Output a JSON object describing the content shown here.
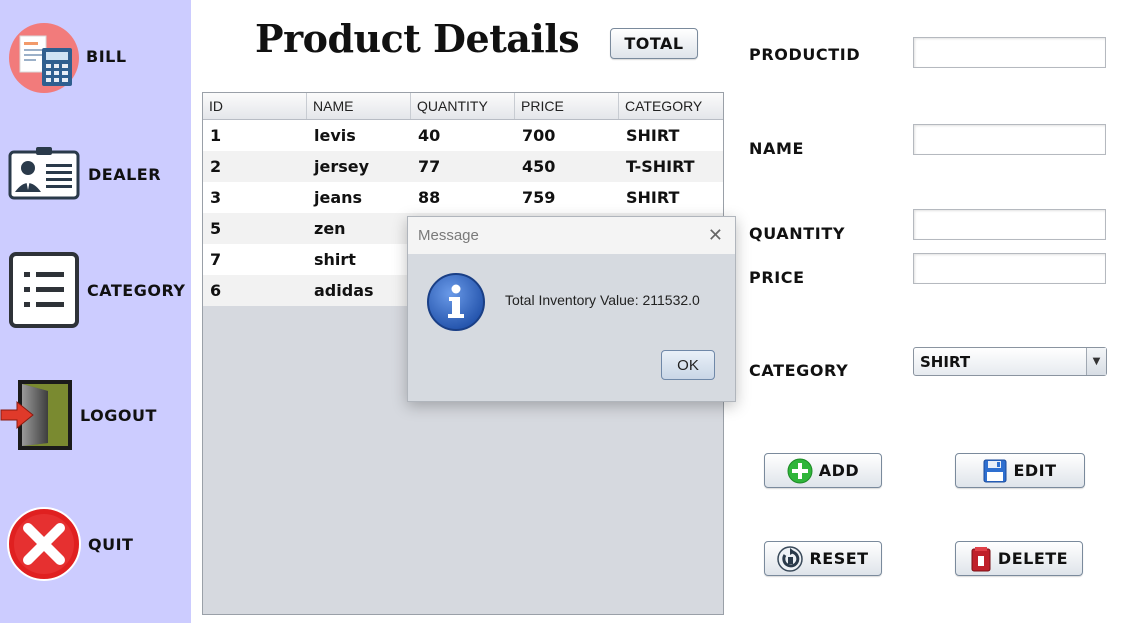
{
  "sidebar": {
    "items": [
      {
        "label": "BILL",
        "icon": "bill-calculator-icon"
      },
      {
        "label": "DEALER",
        "icon": "id-card-icon"
      },
      {
        "label": "CATEGORY",
        "icon": "list-icon"
      },
      {
        "label": "LOGOUT",
        "icon": "logout-door-icon"
      },
      {
        "label": "QUIT",
        "icon": "close-circle-icon"
      }
    ]
  },
  "header": {
    "title": "Product Details",
    "total_label": "TOTAL"
  },
  "table": {
    "columns": [
      "ID",
      "NAME",
      "QUANTITY",
      "PRICE",
      "CATEGORY"
    ],
    "rows": [
      [
        "1",
        "levis",
        "40",
        "700",
        "SHIRT"
      ],
      [
        "2",
        "jersey",
        "77",
        "450",
        "T-SHIRT"
      ],
      [
        "3",
        "jeans",
        "88",
        "759",
        "SHIRT"
      ],
      [
        "5",
        "zen",
        "",
        "",
        ""
      ],
      [
        "7",
        "shirt",
        "",
        "",
        ""
      ],
      [
        "6",
        "adidas",
        "",
        "",
        ""
      ]
    ]
  },
  "form": {
    "productid_label": "PRODUCTID",
    "name_label": "NAME",
    "quantity_label": "QUANTITY",
    "price_label": "PRICE",
    "category_label": "CATEGORY",
    "productid_value": "",
    "name_value": "",
    "quantity_value": "",
    "price_value": "",
    "category_selected": "SHIRT"
  },
  "actions": {
    "add_label": "ADD",
    "edit_label": "EDIT",
    "reset_label": "RESET",
    "delete_label": "DELETE"
  },
  "dialog": {
    "title": "Message",
    "message": "Total Inventory Value: 211532.0",
    "ok_label": "OK",
    "close_glyph": "✕",
    "icon": "info-icon"
  },
  "colors": {
    "sidebar_bg": "#ccccff",
    "info_blue": "#2a5fb4",
    "quit_red": "#e02020"
  }
}
